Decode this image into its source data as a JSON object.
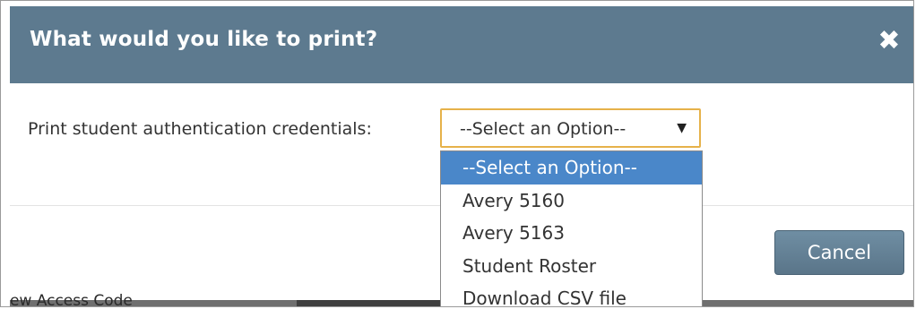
{
  "dialog": {
    "title": "What would you like to print?",
    "close_label": "✖",
    "field_label": "Print student authentication credentials:",
    "select_value": "--Select an Option--",
    "select_arrow": "▼",
    "options": [
      "--Select an Option--",
      "Avery 5160",
      "Avery 5163",
      "Student Roster",
      "Download CSV file"
    ],
    "cancel_label": "Cancel"
  },
  "background": {
    "partial_text": "ew Access Code"
  },
  "colors": {
    "header": "#5d7a8f",
    "select_border": "#e6b24a",
    "option_highlight": "#4a87c9",
    "cancel_button": "#5f7d92"
  }
}
